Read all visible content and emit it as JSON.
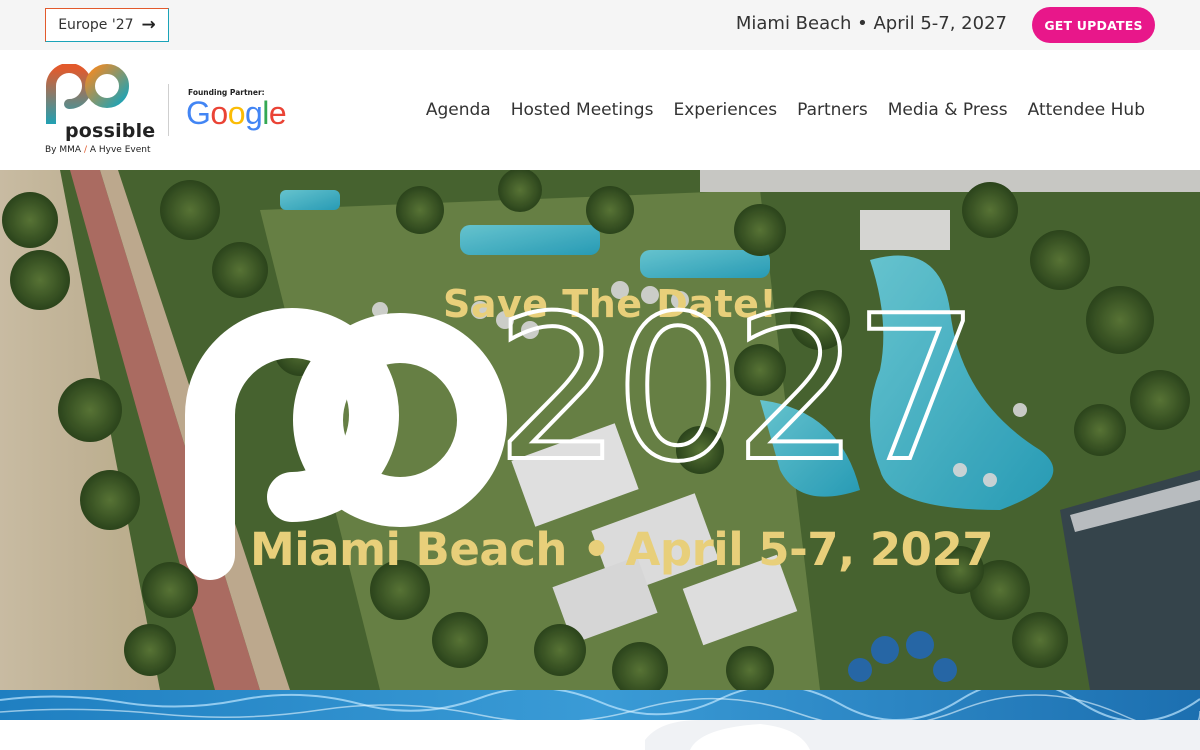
{
  "topbar": {
    "europe_label": "Europe '27",
    "event_info": "Miami Beach • April 5-7, 2027",
    "cta_label": "GET UPDATES"
  },
  "header": {
    "logo_word": "possible",
    "logo_by": "By MMA",
    "logo_slash": "/",
    "logo_hyve": "A Hyve Event",
    "partner_label": "Founding Partner:",
    "partner_name": "Google"
  },
  "nav": {
    "items": [
      "Agenda",
      "Hosted Meetings",
      "Experiences",
      "Partners",
      "Media & Press",
      "Attendee Hub"
    ]
  },
  "hero": {
    "save_the_date": "Save The Date!",
    "year": "2027",
    "location_date": "Miami Beach • April 5-7, 2027"
  },
  "colors": {
    "accent_pink": "#e8178a",
    "brand_teal": "#1aa3b8",
    "brand_orange": "#e25a2c",
    "hero_gold": "#e8cf7a"
  },
  "icons": {
    "arrow": "arrow-right-icon"
  }
}
